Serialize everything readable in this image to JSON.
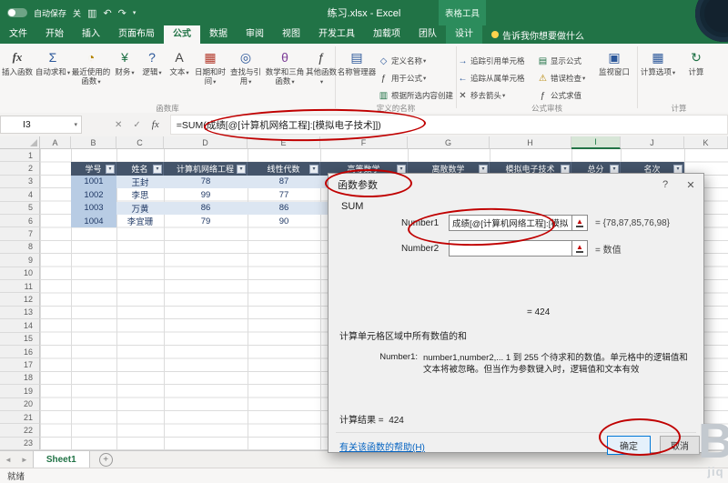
{
  "window": {
    "autosave_label": "自动保存",
    "autosave_state": "关",
    "title": "练习.xlsx - Excel",
    "context_group": "表格工具",
    "tell_me": "告诉我你想要做什么"
  },
  "tabs": [
    "文件",
    "开始",
    "插入",
    "页面布局",
    "公式",
    "数据",
    "审阅",
    "视图",
    "开发工具",
    "加载项",
    "团队",
    "设计"
  ],
  "active_tab": "公式",
  "ribbon": {
    "groups": [
      {
        "label": "函数库",
        "buttons": [
          "插入函数",
          "自动求和",
          "最近使用的函数",
          "财务",
          "逻辑",
          "文本",
          "日期和时间",
          "查找与引用",
          "数学和三角函数",
          "其他函数"
        ]
      },
      {
        "label": "定义的名称",
        "big": "名称管理器",
        "buttons": [
          "定义名称",
          "用于公式",
          "根据所选内容创建"
        ]
      },
      {
        "label": "公式审核",
        "col1": [
          "追踪引用单元格",
          "追踪从属单元格",
          "移去箭头"
        ],
        "col2": [
          "显示公式",
          "错误检查",
          "公式求值"
        ],
        "big": "监视窗口"
      },
      {
        "label": "计算",
        "buttons": [
          "计算选项",
          "计算"
        ]
      }
    ]
  },
  "formula_bar": {
    "cell_ref": "I3",
    "formula": "=SUM(成绩[@[计算机网络工程]:[模拟电子技术]])"
  },
  "sheet": {
    "columns": [
      "A",
      "B",
      "C",
      "D",
      "E",
      "F",
      "G",
      "H",
      "I",
      "J",
      "K"
    ],
    "active_column": "I",
    "row_count": 23,
    "table_headers": [
      "学号",
      "姓名",
      "计算机网络工程",
      "线性代数",
      "高等数学",
      "离散数学",
      "模拟电子技术",
      "总分",
      "名次"
    ],
    "rows": [
      {
        "id": "1001",
        "name": "王封",
        "c1": "78",
        "c2": "87"
      },
      {
        "id": "1002",
        "name": "李思",
        "c1": "99",
        "c2": "77"
      },
      {
        "id": "1003",
        "name": "万黄",
        "c1": "86",
        "c2": "86"
      },
      {
        "id": "1004",
        "name": "李宜珊",
        "c1": "79",
        "c2": "90"
      }
    ]
  },
  "dialog": {
    "title": "函数参数",
    "function_name": "SUM",
    "number1_label": "Number1",
    "number1_value": "成绩[@[计算机网络工程]:[模拟",
    "number1_result": "= {78,87,85,76,98}",
    "number2_label": "Number2",
    "number2_value": "",
    "number2_result": "= 数值",
    "partial_result": "=  424",
    "description": "计算单元格区域中所有数值的和",
    "param_name": "Number1:",
    "param_help": "number1,number2,... 1 到 255 个待求和的数值。单元格中的逻辑值和文本将被忽略。但当作为参数键入时，逻辑值和文本有效",
    "result_label": "计算结果 =",
    "result_value": "424",
    "help_link": "有关该函数的帮助(H)",
    "ok_label": "确定",
    "cancel_label": "取消"
  },
  "sheet_bar": {
    "tab": "Sheet1"
  },
  "status_bar": {
    "ready": "就绪"
  },
  "watermark": {
    "line1": "B",
    "line2": "jiq"
  },
  "icons": {
    "dropdown": "▾",
    "save": "▥",
    "undo": "↶",
    "redo": "↷",
    "insert_function": "fx",
    "autosum": "Σ",
    "recent": "◔",
    "financial": "¥",
    "logical": "?",
    "text": "A",
    "datetime": "▦",
    "lookup": "◎",
    "math": "θ",
    "more": "ƒ",
    "name_manager": "▤",
    "define_name": "◇",
    "use_in_formula": "ƒ",
    "create_from_selection": "▥",
    "trace_precedents": "→",
    "trace_dependents": "←",
    "remove_arrows": "✕",
    "show_formulas": "▤",
    "error_check": "⚠",
    "evaluate": "ƒ",
    "watch": "▣",
    "calc_options": "▦",
    "calc_now": "↻",
    "cancel_x": "✕",
    "check": "✓",
    "fx": "fx",
    "filter": "▾",
    "help": "?",
    "close": "✕",
    "range_select": "▲",
    "prev_sheet": "◄",
    "next_sheet": "►",
    "add_sheet": "+"
  }
}
